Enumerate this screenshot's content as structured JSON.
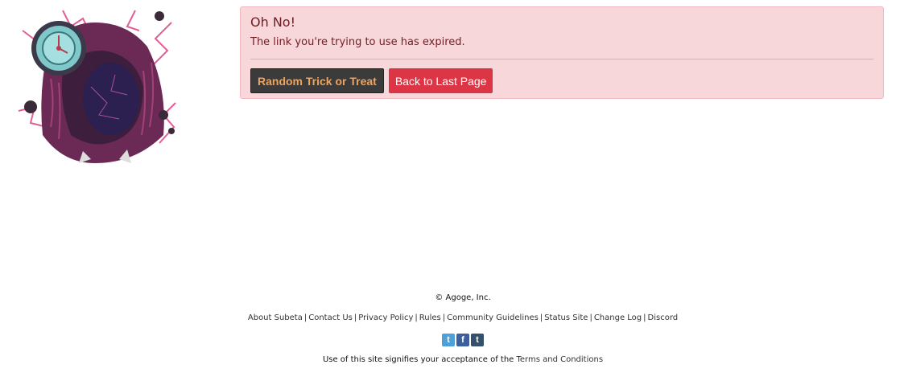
{
  "alert": {
    "title": "Oh No!",
    "message": "The link you're trying to use has expired.",
    "buttons": {
      "trick": "Random Trick or Treat",
      "back": "Back to Last Page"
    }
  },
  "footer": {
    "copyright": "© Agoge, Inc.",
    "links": [
      "About Subeta",
      "Contact Us",
      "Privacy Policy",
      "Rules",
      "Community Guidelines",
      "Status Site",
      "Change Log",
      "Discord"
    ],
    "social": [
      {
        "name": "twitter-icon",
        "glyph": "t"
      },
      {
        "name": "facebook-icon",
        "glyph": "f"
      },
      {
        "name": "tumblr-icon",
        "glyph": "t"
      }
    ],
    "terms_prefix": "Use of this site signifies your acceptance of the",
    "terms_link": "Terms and Conditions"
  },
  "colors": {
    "alert_bg": "#f8d7da",
    "alert_text": "#721c24",
    "trick_btn_bg": "#3b3b3b",
    "trick_btn_text": "#f0a35a",
    "back_btn_bg": "#dc3545"
  }
}
